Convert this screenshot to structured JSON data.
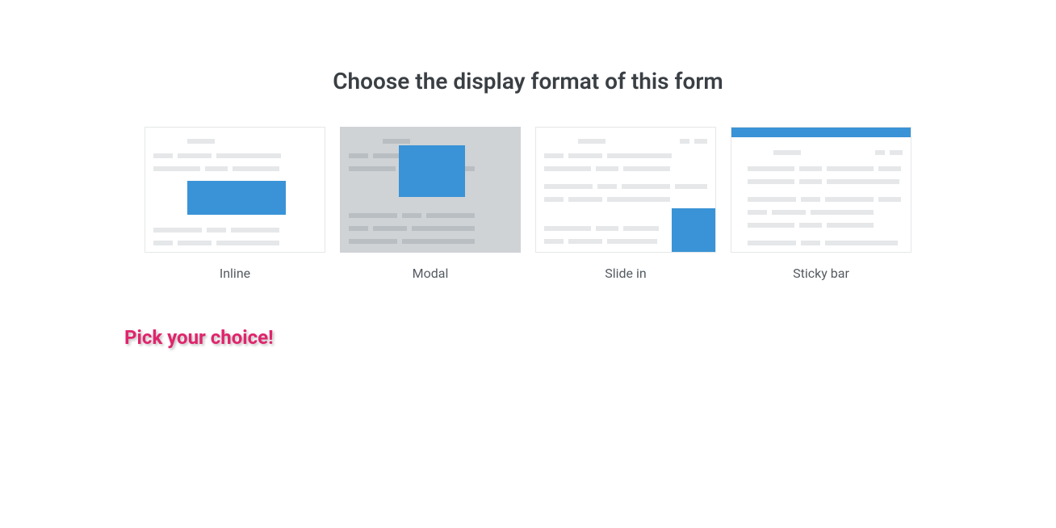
{
  "heading": "Choose the display format of this form",
  "options": [
    {
      "label": "Inline"
    },
    {
      "label": "Modal"
    },
    {
      "label": "Slide in"
    },
    {
      "label": "Sticky bar"
    }
  ],
  "annotation": "Pick your choice!"
}
